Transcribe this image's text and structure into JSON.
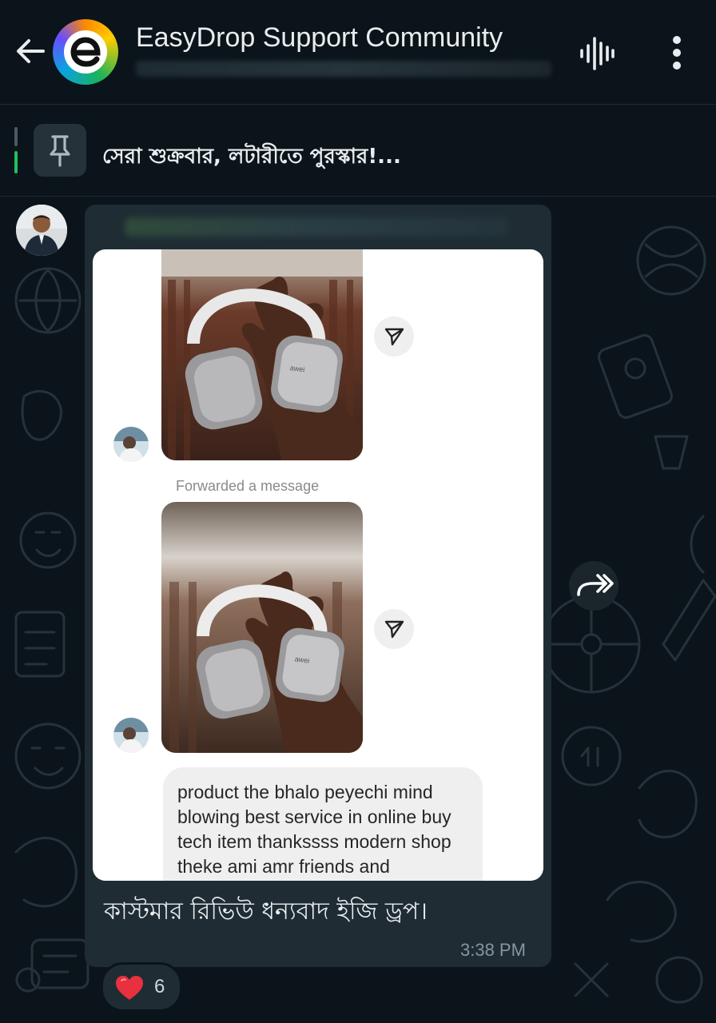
{
  "header": {
    "title": "EasyDrop Support Community",
    "back_icon": "arrow-left-icon",
    "logo_letter": "e",
    "voice_icon": "voice-waveform-icon",
    "menu_icon": "more-vertical-icon"
  },
  "pinned": {
    "text": "সেরা শুক্রবার, লটারীতে পুরস্কার!...",
    "icon": "pin-icon"
  },
  "message": {
    "forwarded_label": "Forwarded a message",
    "review_text": "product the bhalo peyechi mind blowing best service in online buy tech item thankssss modern shop theke ami amr friends and",
    "caption": "কাস্টমার রিভিউ ধন্যবাদ ইজি ড্রপ।",
    "time": "3:38 PM",
    "reaction": {
      "emoji": "heart-icon",
      "count": "6"
    }
  },
  "colors": {
    "background": "#0b141a",
    "bubble": "#1f2c34",
    "accent_green": "#21c063",
    "timestamp": "#8696a0"
  }
}
